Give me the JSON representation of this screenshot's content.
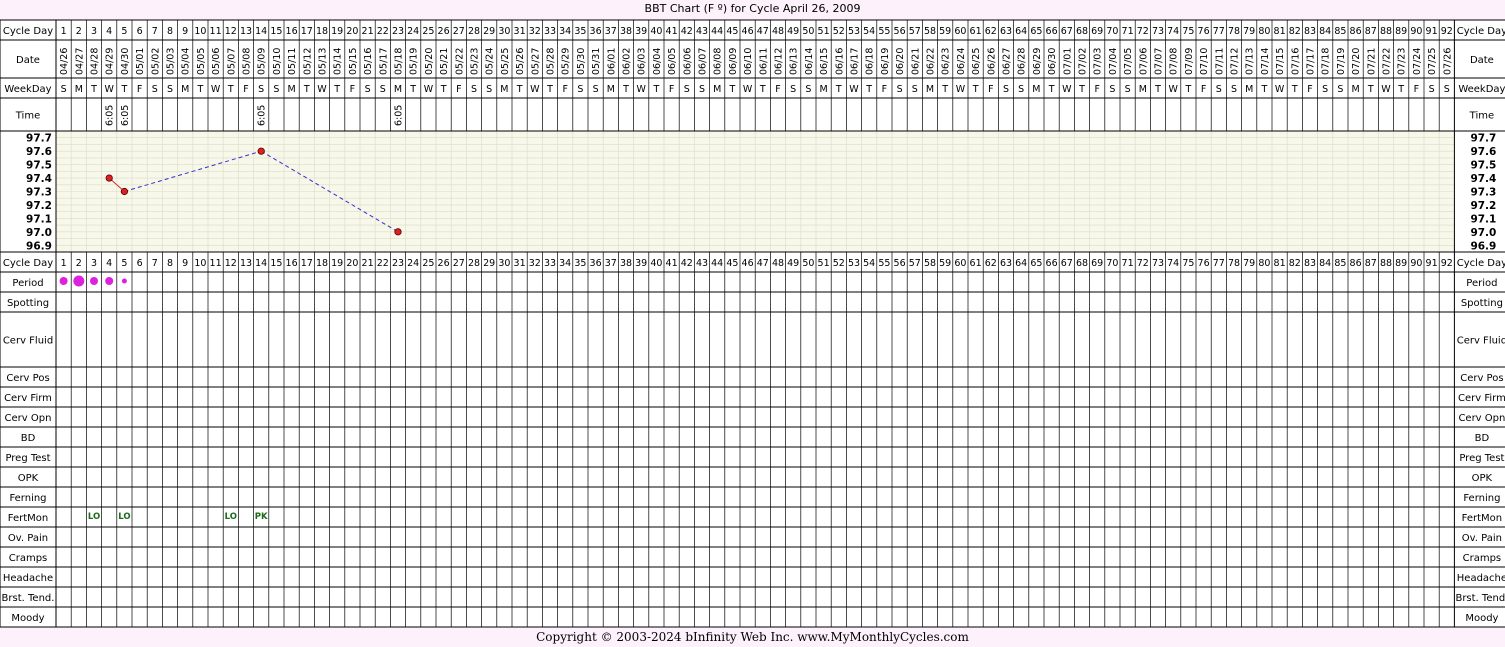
{
  "title": "BBT Chart (F º) for Cycle April 26, 2009",
  "copyright": "Copyright © 2003-2024 bInfinity Web Inc.      www.MyMonthlyCycles.com",
  "colors": {
    "grid": "#000000",
    "chart_bg": "#f7f7ea",
    "chart_grid": "#dcdcc8",
    "point": "#e02020",
    "line_solid": "#cc3333",
    "line_dashed": "#3333cc",
    "period": "#dd22dd",
    "fertmon": "#1a6b1a"
  },
  "row_labels": {
    "cycle_day": "Cycle Day",
    "date": "Date",
    "weekday": "WeekDay",
    "time": "Time",
    "period": "Period",
    "spotting": "Spotting",
    "cerv_fluid": "Cerv Fluid",
    "cerv_pos": "Cerv Pos",
    "cerv_firm": "Cerv Firm",
    "cerv_opn": "Cerv Opn",
    "bd": "BD",
    "preg_test": "Preg Test",
    "opk": "OPK",
    "ferning": "Ferning",
    "fertmon": "FertMon",
    "ov_pain": "Ov. Pain",
    "cramps": "Cramps",
    "headache": "Headache",
    "brst_tend": "Brst. Tend.",
    "moody": "Moody"
  },
  "days": [
    1,
    2,
    3,
    4,
    5,
    6,
    7,
    8,
    9,
    10,
    11,
    12,
    13,
    14,
    15,
    16,
    17,
    18,
    19,
    20,
    21,
    22,
    23,
    24,
    25,
    26,
    27,
    28,
    29,
    30,
    31,
    32,
    33,
    34,
    35,
    36,
    37,
    38,
    39,
    40,
    41,
    42,
    43,
    44,
    45,
    46,
    47,
    48,
    49,
    50,
    51,
    52,
    53,
    54,
    55,
    56,
    57,
    58,
    59,
    60,
    61,
    62,
    63,
    64,
    65,
    66,
    67,
    68,
    69,
    70,
    71,
    72,
    73,
    74,
    75,
    76,
    77,
    78,
    79,
    80,
    81,
    82,
    83,
    84,
    85,
    86,
    87,
    88,
    89,
    90,
    91,
    92
  ],
  "dates": [
    "04/26",
    "04/27",
    "04/28",
    "04/29",
    "04/30",
    "05/01",
    "05/02",
    "05/03",
    "05/04",
    "05/05",
    "05/06",
    "05/07",
    "05/08",
    "05/09",
    "05/10",
    "05/11",
    "05/12",
    "05/13",
    "05/14",
    "05/15",
    "05/16",
    "05/17",
    "05/18",
    "05/19",
    "05/20",
    "05/21",
    "05/22",
    "05/23",
    "05/24",
    "05/25",
    "05/26",
    "05/27",
    "05/28",
    "05/29",
    "05/30",
    "05/31",
    "06/01",
    "06/02",
    "06/03",
    "06/04",
    "06/05",
    "06/06",
    "06/07",
    "06/08",
    "06/09",
    "06/10",
    "06/11",
    "06/12",
    "06/13",
    "06/14",
    "06/15",
    "06/16",
    "06/17",
    "06/18",
    "06/19",
    "06/20",
    "06/21",
    "06/22",
    "06/23",
    "06/24",
    "06/25",
    "06/26",
    "06/27",
    "06/28",
    "06/29",
    "06/30",
    "07/01",
    "07/02",
    "07/03",
    "07/04",
    "07/05",
    "07/06",
    "07/07",
    "07/08",
    "07/09",
    "07/10",
    "07/11",
    "07/12",
    "07/13",
    "07/14",
    "07/15",
    "07/16",
    "07/17",
    "07/18",
    "07/19",
    "07/20",
    "07/21",
    "07/22",
    "07/23",
    "07/24",
    "07/25",
    "07/26"
  ],
  "weekdays": [
    "S",
    "M",
    "T",
    "W",
    "T",
    "F",
    "S",
    "S",
    "M",
    "T",
    "W",
    "T",
    "F",
    "S",
    "S",
    "M",
    "T",
    "W",
    "T",
    "F",
    "S",
    "S",
    "M",
    "T",
    "W",
    "T",
    "F",
    "S",
    "S",
    "M",
    "T",
    "W",
    "T",
    "F",
    "S",
    "S",
    "M",
    "T",
    "W",
    "T",
    "F",
    "S",
    "S",
    "M",
    "T",
    "W",
    "T",
    "F",
    "S",
    "S",
    "M",
    "T",
    "W",
    "T",
    "F",
    "S",
    "S",
    "M",
    "T",
    "W",
    "T",
    "F",
    "S",
    "S",
    "M",
    "T",
    "W",
    "T",
    "F",
    "S",
    "S",
    "M",
    "T",
    "W",
    "T",
    "F",
    "S",
    "S",
    "M",
    "T",
    "W",
    "T",
    "F",
    "S",
    "S",
    "M",
    "T",
    "W",
    "T",
    "F",
    "S",
    "S"
  ],
  "chart_data": {
    "type": "line",
    "title": "BBT Chart (F º) for Cycle April 26, 2009",
    "ylim": [
      96.85,
      97.75
    ],
    "y_ticks": [
      "97.7",
      "97.6",
      "97.5",
      "97.4",
      "97.3",
      "97.2",
      "97.1",
      "97.0",
      "96.9"
    ],
    "points": [
      {
        "day": 4,
        "temp": 97.4
      },
      {
        "day": 5,
        "temp": 97.3
      },
      {
        "day": 14,
        "temp": 97.6
      },
      {
        "day": 23,
        "temp": 97.0
      }
    ],
    "segments": [
      {
        "from": 0,
        "to": 1,
        "style": "solid"
      },
      {
        "from": 1,
        "to": 2,
        "style": "dashed"
      },
      {
        "from": 2,
        "to": 3,
        "style": "dashed"
      }
    ],
    "times": [
      {
        "day": 4,
        "text": "6:05"
      },
      {
        "day": 5,
        "text": "6:05"
      },
      {
        "day": 14,
        "text": "6:05"
      },
      {
        "day": 23,
        "text": "6:05"
      }
    ],
    "period": [
      {
        "day": 1,
        "level": "medium"
      },
      {
        "day": 2,
        "level": "heavy"
      },
      {
        "day": 3,
        "level": "medium"
      },
      {
        "day": 4,
        "level": "medium"
      },
      {
        "day": 5,
        "level": "light"
      }
    ],
    "fertmon": [
      {
        "day": 3,
        "text": "LO"
      },
      {
        "day": 5,
        "text": "LO"
      },
      {
        "day": 12,
        "text": "LO"
      },
      {
        "day": 14,
        "text": "PK"
      }
    ]
  }
}
